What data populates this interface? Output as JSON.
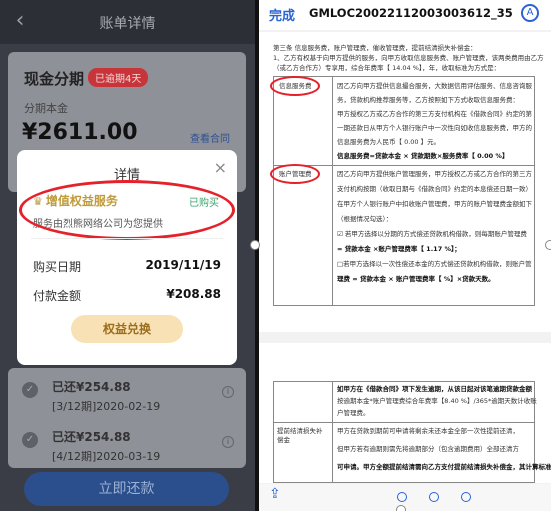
{
  "left": {
    "nav_title": "账单详情",
    "back_icon": "chevron-left-icon",
    "card": {
      "title": "现金分期",
      "overdue_badge": "已逾期4天",
      "principal_label": "分期本金",
      "principal_amount": "¥2611.00",
      "contract_link": "查看合同"
    },
    "modal": {
      "title": "详情",
      "close": "×",
      "service_name": "增值权益服务",
      "bought": "已购买",
      "provider": "服务由烈熊网络公司为您提供",
      "purchase_date_label": "购买日期",
      "purchase_date": "2019/11/19",
      "amount_label": "付款金额",
      "amount": "¥208.88",
      "redeem_button": "权益兑换"
    },
    "installments": [
      {
        "status": "已还¥254.88",
        "period": "[3/12期]2020-02-19"
      },
      {
        "status": "已还¥254.88",
        "period": "[4/12期]2020-03-19"
      }
    ],
    "pay_button": "立即还款"
  },
  "right": {
    "done": "完成",
    "file_name": "GMLOC20022112003003612_35",
    "doc": {
      "intro1": "第三条  信息服务费，账户管理费，催收管理费，提前结清损失补偿金：",
      "intro2": "1、乙方有权基于向甲方提供的服务，向甲方收取信息服务费、账户管理费，该两类费用由乙方",
      "intro3": "（或乙方合作方）专享用，综合年费率【 14.04 %】，年，收取标准为方式是：",
      "info_label": "信息服务费",
      "info_text": [
        "因乙方向甲方提供信息撮合服务，大数据信用评估服务、信息咨询服",
        "务，贷款机构推荐服务等，乙方按照如下方式收取信息服务费：",
        "甲方授权乙方或乙方合作的第三方支付机构在《借款合同》约定的第",
        "一期还款日从甲方个人银行账户中一次性向如收信息服务费，甲方的",
        "信息服务费为人民币【  0.00  】元。"
      ],
      "info_formula": "信息服务费=贷款本金 × 贷款期数×服务费率【  0.00 %】",
      "account_label": "账户管理费",
      "account_text": [
        "因乙方向甲方提供账户管理服务，甲方授权乙方或乙方合作的第三方",
        "支付机构按期（收取日期与《借款合同》约定的本息偿还日期一致）",
        "在甲方个人银行账户中扣收账户管理费，甲方的账户管理费金额如下",
        "（根据情况勾选）：",
        "☑ 若甲方选择以分期的方式偿还贷款机构借款，则每期账户管理费",
        "= 贷款本金 ×账户管理费率【  1.17  %】；",
        "□若甲方选择以一次性偿还本金的方式偿还贷款机构借款，则账户管",
        "理费 = 贷款本金 × 账户管理费率【      %】×贷款天数。"
      ],
      "page2_row1": [
        "如甲方在《借款合同》项下发生逾期，从该日起对该笔逾期贷款金额",
        "按逾期本金*账户管理费综合年费率【8.40 %】/365*逾期天数计收账",
        "户管理费。"
      ],
      "prepay_label": "提前结清损失补偿金",
      "prepay_text": [
        "甲方在贷款到期前可申请将剩余未还本金全部一次性提前还清，",
        "但甲方若有逾期则需先将逾期部分（包含逾期费用）全部还清方",
        "可申请。甲方全额提前结清需向乙方支付提前结清损失补偿金，其计算标准"
      ]
    }
  }
}
